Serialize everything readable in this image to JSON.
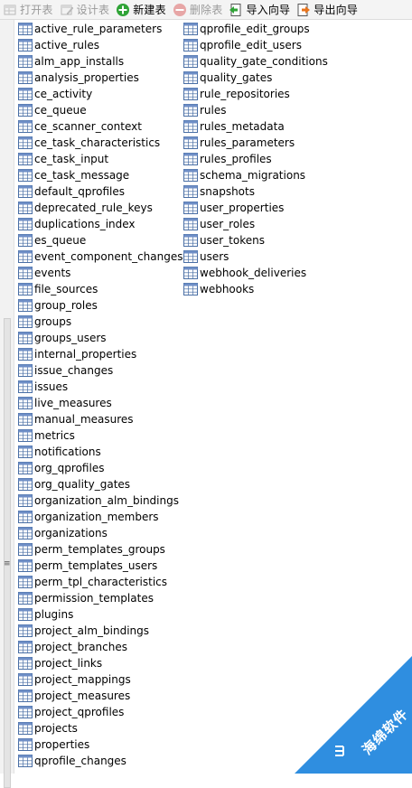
{
  "toolbar": {
    "buttons": [
      {
        "label": "打开表",
        "icon": "open-table-icon",
        "enabled": false
      },
      {
        "label": "设计表",
        "icon": "design-table-icon",
        "enabled": false
      },
      {
        "label": "新建表",
        "icon": "new-table-icon",
        "enabled": true
      },
      {
        "label": "删除表",
        "icon": "delete-table-icon",
        "enabled": false
      },
      {
        "label": "导入向导",
        "icon": "import-wizard-icon",
        "enabled": true
      },
      {
        "label": "导出向导",
        "icon": "export-wizard-icon",
        "enabled": true
      }
    ]
  },
  "tables": {
    "column1": [
      "active_rule_parameters",
      "active_rules",
      "alm_app_installs",
      "analysis_properties",
      "ce_activity",
      "ce_queue",
      "ce_scanner_context",
      "ce_task_characteristics",
      "ce_task_input",
      "ce_task_message",
      "default_qprofiles",
      "deprecated_rule_keys",
      "duplications_index",
      "es_queue",
      "event_component_changes",
      "events",
      "file_sources",
      "group_roles",
      "groups",
      "groups_users",
      "internal_properties",
      "issue_changes",
      "issues",
      "live_measures",
      "manual_measures",
      "metrics",
      "notifications",
      "org_qprofiles",
      "org_quality_gates",
      "organization_alm_bindings",
      "organization_members",
      "organizations",
      "perm_templates_groups",
      "perm_templates_users",
      "perm_tpl_characteristics",
      "permission_templates",
      "plugins",
      "project_alm_bindings",
      "project_branches",
      "project_links",
      "project_mappings",
      "project_measures",
      "project_qprofiles",
      "projects",
      "properties",
      "qprofile_changes"
    ],
    "column2": [
      "qprofile_edit_groups",
      "qprofile_edit_users",
      "quality_gate_conditions",
      "quality_gates",
      "rule_repositories",
      "rules",
      "rules_metadata",
      "rules_parameters",
      "rules_profiles",
      "schema_migrations",
      "snapshots",
      "user_properties",
      "user_roles",
      "user_tokens",
      "users",
      "webhook_deliveries",
      "webhooks"
    ]
  },
  "watermark": {
    "text": "海绵软件",
    "color": "#2f8ee0"
  },
  "colors": {
    "table_icon_stroke": "#4a6fa5",
    "table_icon_header": "#6f8fc7"
  }
}
